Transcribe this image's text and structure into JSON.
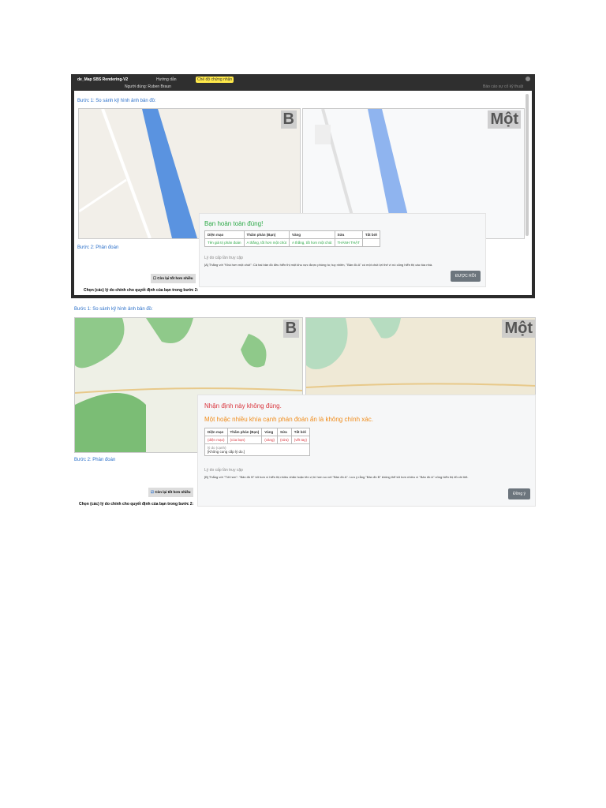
{
  "shot1": {
    "app_title": "de_Map SBS Rendering-V2",
    "menu_guide": "Hướng dẫn",
    "user_label": "Người dùng: Ruben Braun",
    "cert_badge": "Chế độ chứng nhận",
    "right_link": "Báo cáo sự cố kỹ thuật",
    "step1": "Bước 1: So sánh kỹ hình ảnh bản đồ:",
    "map_b_label": "B",
    "map_a_label": "Một",
    "step2": "Bước 2: Phân đoán",
    "checkbox_label": "Còn lại tốt hơn nhiều",
    "footer_text": "Chọn (các) lý do chính cho quyết định của bạn trong bước 2:",
    "dialog": {
      "title": "Bạn hoàn toàn đúng!",
      "headers": [
        "Diện mạo",
        "Thẩm phán (Bạn)",
        "Vàng",
        "Sửa",
        "Tất bởi"
      ],
      "row": [
        "Tên giá trị phán đoán",
        "A thắng, tốt hơn một chút",
        "A thắng, tốt hơn một chút",
        "THÀNH THẬT",
        ""
      ],
      "reason_label": "Lý do cấp lần truy cập",
      "reason_text": "[A] Thắng với \"Khá hơn một chút\": Cả hai bản đồ đều hiển thị một khu vực được phòng to; tuy nhiên, \"Bản đồ A\" có một chút lợi thế vì nó cũng hiển thị các tòa nhà.",
      "ok_button": "ĐƯỢC RỒI"
    }
  },
  "shot2": {
    "step1": "Bước 1: So sánh kỹ hình ảnh bản đồ:",
    "map_b_label": "B",
    "map_a_label": "Một",
    "step2": "Bước 2: Phân đoán",
    "checkbox_label": "Còn lại tốt hơn nhiều",
    "footer_text": "Chọn (các) lý do chính cho quyết định của bạn trong bước 2:",
    "dialog": {
      "title": "Nhận định này không đúng.",
      "subtitle": "Một hoặc nhiều khía cạnh phán đoán ẩn là không chính xác.",
      "headers": [
        "Diện mạo",
        "Thẩm phán (Bạn)",
        "Vàng",
        "Sửa",
        "Tất bởi"
      ],
      "row": [
        "(diện mạo)",
        "(của bạn)",
        "(vàng)",
        "(sửa)",
        "(vết tay)"
      ],
      "reason_cell_label": "lý do (cạnh)",
      "reason_cell_text": "[Không cung cấp lý do.]",
      "reason_label": "Lý do cấp lần truy cập",
      "reason_text": "[B] Thắng với \"Tốt hơn\": \"Bản đồ B\" tốt hơn vì hiển thị nhiều nhãn hoặc tên vị trí hơn so với \"Bản đồ A\". Lưu ý rằng \"Bản đồ B\" không thể tốt hơn nhiều vì \"Bản đồ A\" cũng hiển thị đủ chi tiết.",
      "ok_button": "Đồng ý"
    }
  }
}
